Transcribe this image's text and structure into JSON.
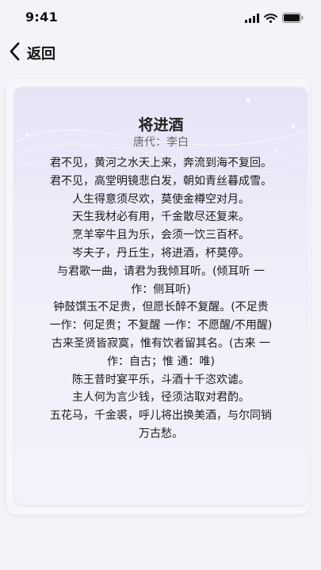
{
  "status_bar": {
    "time": "9:41",
    "icons": [
      "signal-icon",
      "wifi-icon",
      "battery-icon"
    ]
  },
  "nav": {
    "back_label": "返回",
    "back_icon": "chevron-left-icon"
  },
  "poem": {
    "title": "将进酒",
    "author": "唐代：李白",
    "lines": [
      "君不见，黄河之水天上来，奔流到海不复回。",
      "君不见，高堂明镜悲白发，朝如青丝暮成雪。",
      "人生得意须尽欢，莫使金樽空对月。",
      "天生我材必有用，千金散尽还复来。",
      "烹羊宰牛且为乐，会须一饮三百杯。",
      "岑夫子，丹丘生，将进酒，杯莫停。",
      "与君歌一曲，请君为我倾耳听。(倾耳听 一",
      "作：侧耳听)",
      "钟鼓馔玉不足贵，但愿长醉不复醒。(不足贵",
      "一作：何足贵；不复醒 一作：不愿醒/不用醒)",
      "古来圣贤皆寂寞，惟有饮者留其名。(古来 一",
      "作：自古；惟 通：唯)",
      "陈王昔时宴平乐，斗酒十千恣欢谑。",
      "主人何为言少钱，径须沽取对君酌。",
      "五花马，千金裘，呼儿将出换美酒，与尔同销",
      "万古愁。"
    ]
  },
  "colors": {
    "background": "#f4f3f8",
    "card_gradient_top": "#e6e3f6",
    "card_gradient_bottom": "#f3f2fb",
    "text": "#1a1a1a",
    "author": "#6b6b6b"
  }
}
